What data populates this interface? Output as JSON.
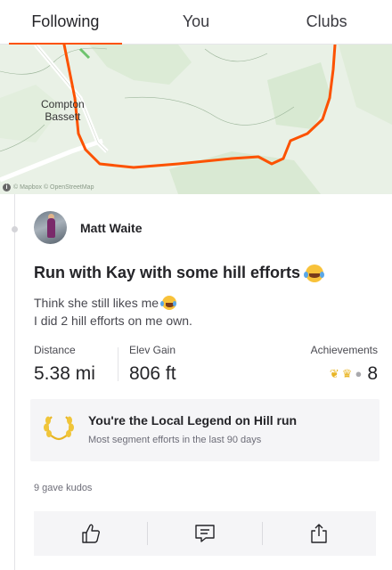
{
  "tabs": [
    {
      "label": "Following",
      "active": true
    },
    {
      "label": "You",
      "active": false
    },
    {
      "label": "Clubs",
      "active": false
    }
  ],
  "map": {
    "place_label_line1": "Compton",
    "place_label_line2": "Bassett",
    "attribution": "© Mapbox © OpenStreetMap",
    "route_color": "#fc5200"
  },
  "activity": {
    "athlete_name": "Matt Waite",
    "title": "Run with Kay with some hill efforts",
    "description_line1": "Think she still likes me",
    "description_line2": "I did 2 hill efforts on me own.",
    "title_emoji": "laughing-emoji-icon",
    "stats": {
      "distance_label": "Distance",
      "distance_value": "5.38 mi",
      "elev_label": "Elev Gain",
      "elev_value": "806 ft",
      "achievements_label": "Achievements",
      "achievements_count": "8",
      "achievement_icons": [
        "laurel-icon",
        "crown-icon",
        "silver-medal-icon"
      ]
    },
    "local_legend": {
      "title": "You're the Local Legend on Hill run",
      "subtitle": "Most segment efforts in the last 90 days"
    },
    "kudos_text": "9 gave kudos",
    "actions": [
      "kudos-thumb-icon",
      "comment-icon",
      "share-icon"
    ]
  },
  "colors": {
    "accent": "#fc5200",
    "gold": "#e8b524",
    "panel": "#f5f5f7"
  }
}
